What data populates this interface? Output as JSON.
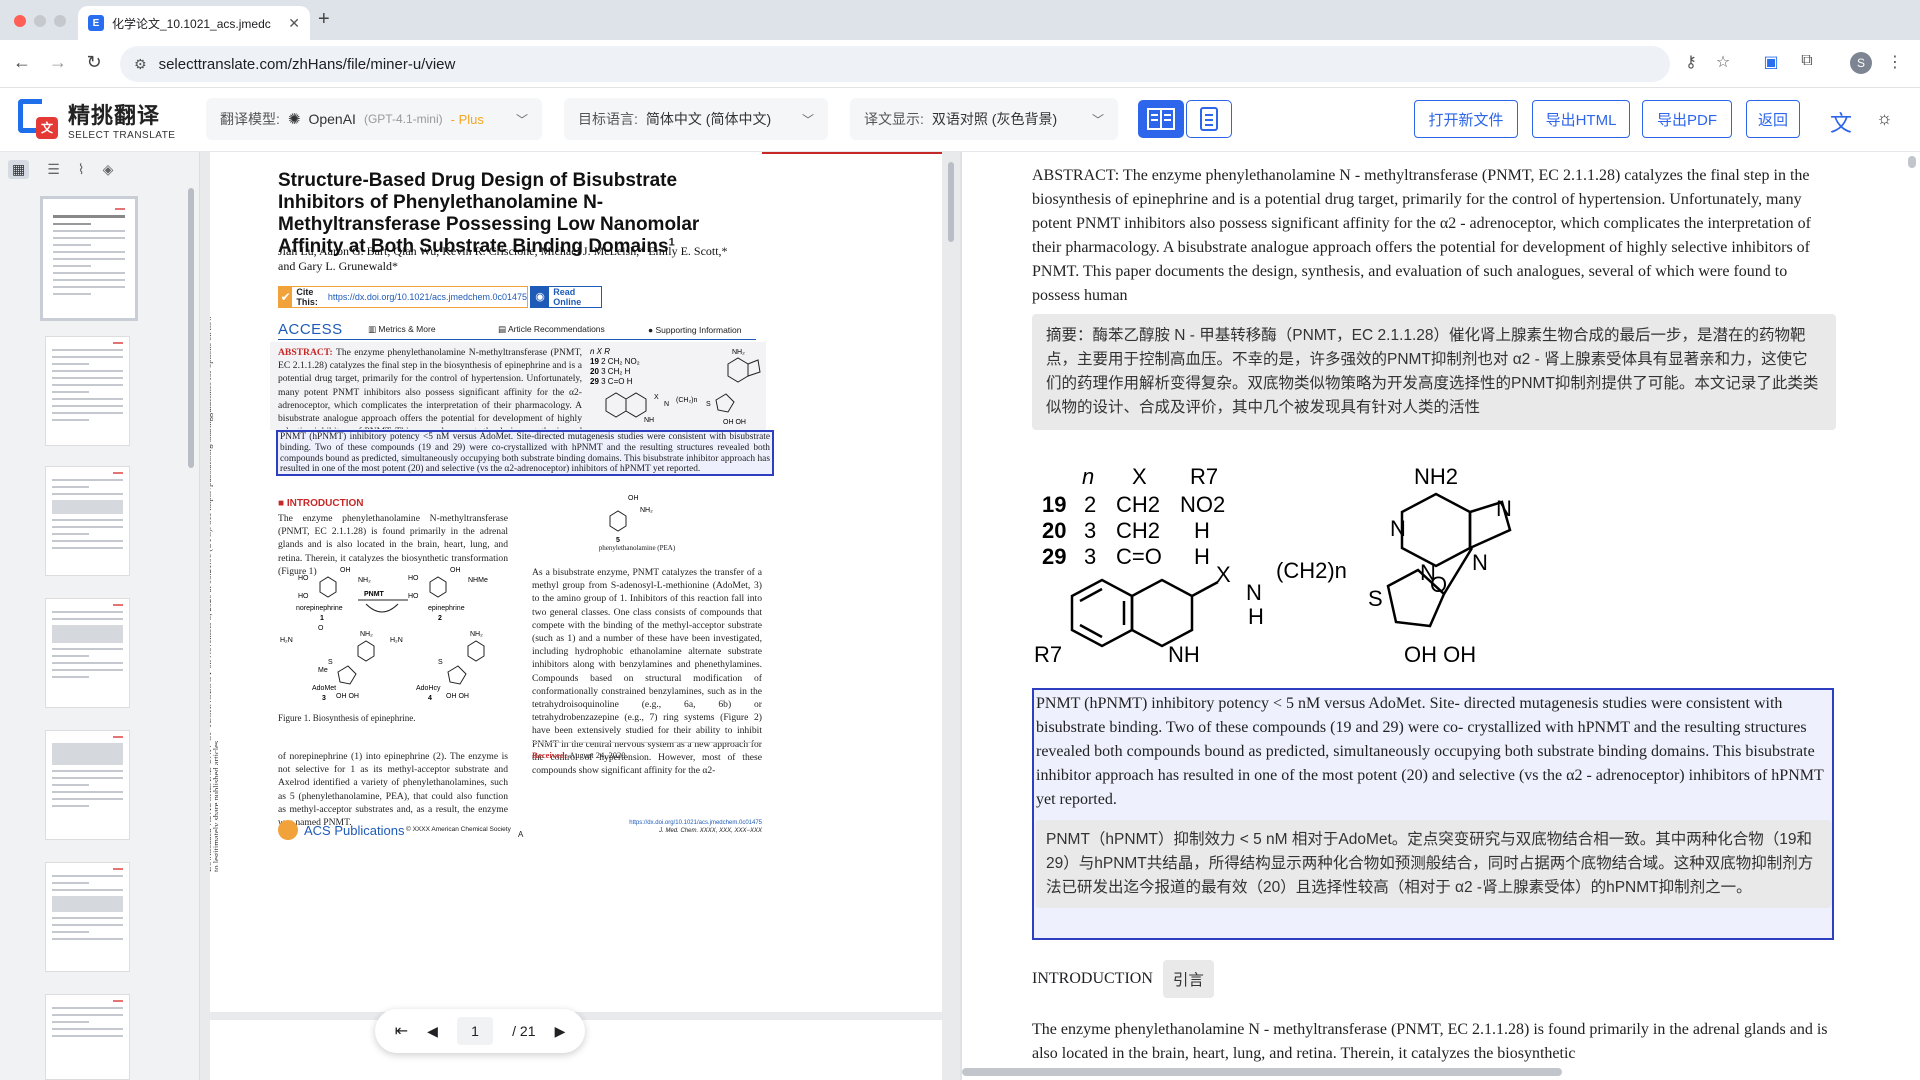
{
  "browser": {
    "tab_title": "化学论文_10.1021_acs.jmedc",
    "url": "selecttranslate.com/zhHans/file/miner-u/view",
    "profile_initial": "S"
  },
  "app": {
    "logo_name": "精挑翻译",
    "logo_sub": "SELECT TRANSLATE",
    "model_label": "翻译模型:",
    "model_name": "OpenAI",
    "model_version": "(GPT-4.1-mini)",
    "model_tier": "- Plus",
    "target_label": "目标语言:",
    "target_value": "简体中文 (简体中文)",
    "display_label": "译文显示:",
    "display_value": "双语对照 (灰色背景)",
    "btn_open": "打开新文件",
    "btn_html": "导出HTML",
    "btn_pdf": "导出PDF",
    "btn_back": "返回"
  },
  "pager": {
    "current": "1",
    "total": "/ 21"
  },
  "pdf": {
    "title": "Structure-Based Drug Design of Bisubstrate Inhibitors of Phenylethanolamine N-Methyltransferase Possessing Low Nanomolar Affinity at Both Substrate Binding Domains",
    "title_sup": "1",
    "authors": "Jian Lu, Aaron G. Bart, Qian Wu, Kevin R. Criscione, Michael J. McLeish,* Emily E. Scott,* and Gary L. Grunewald*",
    "cite_label": "Cite This:",
    "cite_link": "https://dx.doi.org/10.1021/acs.jmedchem.0c01475",
    "read_online": "Read Online",
    "access": "ACCESS",
    "metrics": "Metrics & More",
    "recs": "Article Recommendations",
    "supp": "Supporting Information",
    "abstract_head": "ABSTRACT:",
    "abstract_body": "The enzyme phenylethanolamine N-methyltransferase (PNMT, EC 2.1.1.28) catalyzes the final step in the biosynthesis of epinephrine and is a potential drug target, primarily for the control of hypertension. Unfortunately, many potent PNMT inhibitors also possess significant affinity for the α2-adrenoceptor, which complicates the interpretation of their pharmacology. A bisubstrate analogue approach offers the potential for development of highly selective inhibitors of PNMT. This paper documents the design, synthesis, and evaluation of such analogues, several of which were found to possess human",
    "abstract_sel": "PNMT (hPNMT) inhibitory potency <5 nM versus AdoMet. Site-directed mutagenesis studies were consistent with bisubstrate binding. Two of these compounds (19 and 29) were co-crystallized with hPNMT and the resulting structures revealed both compounds bound as predicted, simultaneously occupying both substrate binding domains. This bisubstrate inhibitor approach has resulted in one of the most potent (20) and selective (vs the α2-adrenoceptor) inhibitors of hPNMT yet reported.",
    "intro_head": "INTRODUCTION",
    "intro_p1": "The enzyme phenylethanolamine N-methyltransferase (PNMT, EC 2.1.1.28) is found primarily in the adrenal glands and is also located in the brain, heart, lung, and retina. Therein, it catalyzes the biosynthetic transformation (Figure 1)",
    "fig1_caption": "Figure 1. Biosynthesis of epinephrine.",
    "intro_p2": "of norepinephrine (1) into epinephrine (2). The enzyme is not selective for 1 as its methyl-acceptor substrate and Axelrod identified a variety of phenylethanolamines, such as 5 (phenylethanolamine, PEA), that could also function as methyl-acceptor substrates and, as a result, the enzyme was named PNMT.",
    "right_col": "As a bisubstrate enzyme, PNMT catalyzes the transfer of a methyl group from S-adenosyl-L-methionine (AdoMet, 3) to the amino group of 1. Inhibitors of this reaction fall into two general classes. One class consists of compounds that compete with the binding of the methyl-acceptor substrate (such as 1) and a number of these have been investigated, including hydrophobic ethanolamine alternate substrate inhibitors along with benzylamines and phenethylamines. Compounds based on structural modification of conformationally constrained benzylamines, such as in the tetrahydroisoquinoline (e.g., 6a, 6b) or tetrahydrobenzazepine (e.g., 7) ring systems (Figure 2) have been extensively studied for their ability to inhibit PNMT in the central nervous system as a new approach for the control of hypertension. However, most of these compounds show significant affinity for the α2-",
    "received_label": "Received:",
    "received_date": "August 24, 2020",
    "pea_label": "phenylethanolamine (PEA)",
    "pea_num": "5",
    "acs_pub": "ACS Publications",
    "copyright": "© XXXX American Chemical Society",
    "page_letter": "A",
    "foot_doi": "https://dx.doi.org/10.1021/acs.jmedchem.0c01475",
    "foot_journal": "J. Med. Chem. XXXX, XXX, XXX−XXX",
    "side_note": "Downloaded via AUCKLAND UNIV OF TECHNOLOGY on November 5, 2020 at 08:21:06 (UTC). See https://pubs.acs.org/sharingguidelines for options on how to legitimately share published articles.",
    "fig_labels": {
      "norepi": "norepinephrine",
      "epi": "epinephrine",
      "pnmt": "PNMT",
      "adomet": "AdoMet",
      "adohcy": "AdoHcy",
      "n1": "1",
      "n2": "2",
      "n3": "3",
      "n4": "4"
    }
  },
  "translation": {
    "p1_en": "ABSTRACT: The enzyme phenylethanolamine N - methyltransferase (PNMT, EC 2.1.1.28) catalyzes the final step in the biosynthesis of epinephrine and is a potential drug target, primarily for the control of hypertension. Unfortunately, many potent PNMT inhibitors also possess significant affinity for the α2 - adrenoceptor, which complicates the interpretation of their pharmacology. A bisubstrate analogue approach offers the potential for development of highly selective inhibitors of PNMT. This paper documents the design, synthesis, and evaluation of such analogues, several of which were found to possess human",
    "p1_zh": "摘要：酶苯乙醇胺 N - 甲基转移酶（PNMT，EC 2.1.1.28）催化肾上腺素生物合成的最后一步，是潜在的药物靶点，主要用于控制高血压。不幸的是，许多强效的PNMT抑制剂也对 α2 - 肾上腺素受体具有显著亲和力，这使它们的药理作用解析变得复杂。双底物类似物策略为开发高度选择性的PNMT抑制剂提供了可能。本文记录了此类类似物的设计、合成及评价，其中几个被发现具有针对人类的活性",
    "p2_en": "PNMT (hPNMT) inhibitory potency < 5 nM versus AdoMet. Site- directed mutagenesis studies were consistent with bisubstrate binding. Two of these compounds (19 and 29) were co- crystallized with hPNMT and the resulting structures revealed both compounds bound as predicted, simultaneously occupying both substrate binding domains. This bisubstrate inhibitor approach has resulted in one of the most potent (20) and selective (vs the α2 - adrenoceptor) inhibitors of hPNMT yet reported.",
    "p2_zh": "PNMT（hPNMT）抑制效力 < 5 nM 相对于AdoMet。定点突变研究与双底物结合相一致。其中两种化合物（19和29）与hPNMT共结晶，所得结构显示两种化合物如预测般结合，同时占据两个底物结合域。这种双底物抑制剂方法已研发出迄今报道的最有效（20）且选择性较高（相对于 α2 -肾上腺素受体）的hPNMT抑制剂之一。",
    "intro_en": "INTRODUCTION",
    "intro_zh": "引言",
    "p3_en": "The enzyme phenylethanolamine N - methyltransferase (PNMT, EC 2.1.1.28) is found primarily in the adrenal glands and is also located in the brain, heart, lung, and retina. Therein, it catalyzes the biosynthetic",
    "chem_table": {
      "head": [
        "n",
        "X",
        "R7"
      ],
      "rows": [
        [
          "19",
          "2",
          "CH2",
          "NO2"
        ],
        [
          "20",
          "3",
          "CH2",
          "H"
        ],
        [
          "29",
          "3",
          "C=O",
          "H"
        ]
      ]
    },
    "chem_labels": {
      "nh2": "NH2",
      "n": "N",
      "x": "X",
      "nh": "NH",
      "h": "H",
      "chain": "(CH2)n",
      "s": "S",
      "o": "O",
      "ohoh": "OH OH",
      "r7": "R7",
      "dash": "-"
    }
  }
}
